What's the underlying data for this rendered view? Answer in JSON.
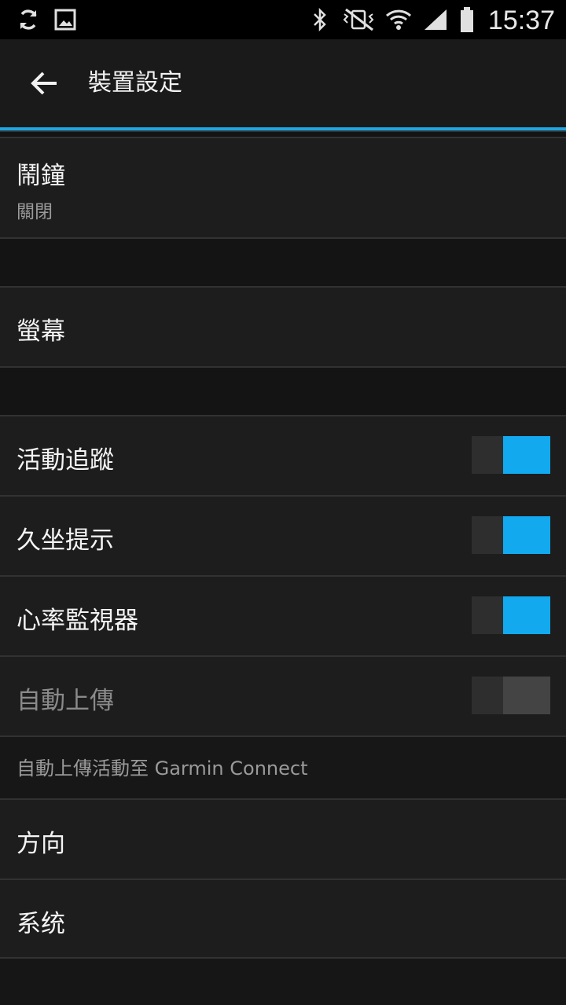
{
  "status_bar": {
    "time": "15:37",
    "left_icons": [
      "sync-icon",
      "image-icon"
    ],
    "right_icons": [
      "bluetooth-icon",
      "vibrate-mute-icon",
      "wifi-icon",
      "signal-icon",
      "battery-icon"
    ]
  },
  "header": {
    "title": "裝置設定",
    "accent_color": "#1ea8e3"
  },
  "settings": {
    "alarm": {
      "label": "鬧鐘",
      "value": "關閉"
    },
    "screen": {
      "label": "螢幕"
    },
    "activity_tracking": {
      "label": "活動追蹤",
      "enabled": true
    },
    "move_alert": {
      "label": "久坐提示",
      "enabled": true
    },
    "heart_rate_monitor": {
      "label": "心率監視器",
      "enabled": true
    },
    "auto_upload": {
      "label": "自動上傳",
      "enabled": false,
      "disabled": true
    },
    "auto_upload_caption": "自動上傳活動至 Garmin Connect",
    "orientation": {
      "label": "方向"
    },
    "system": {
      "label": "系统"
    }
  },
  "colors": {
    "toggle_on": "#12a9ef",
    "toggle_off": "#444444",
    "background": "#161616"
  }
}
